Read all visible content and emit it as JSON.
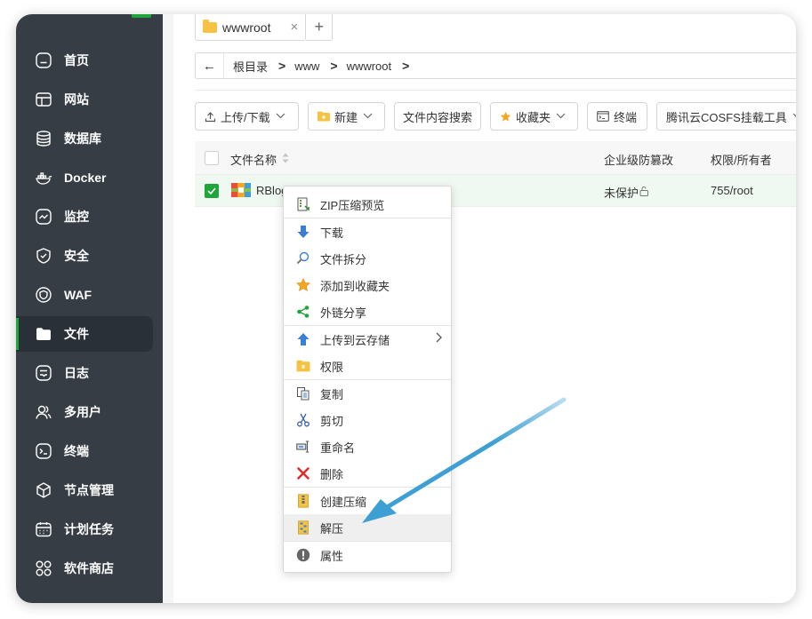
{
  "sidebar": {
    "items": [
      {
        "label": "首页",
        "icon": "home-icon"
      },
      {
        "label": "网站",
        "icon": "website-icon"
      },
      {
        "label": "数据库",
        "icon": "database-icon"
      },
      {
        "label": "Docker",
        "icon": "docker-icon"
      },
      {
        "label": "监控",
        "icon": "monitor-icon"
      },
      {
        "label": "安全",
        "icon": "shield-icon"
      },
      {
        "label": "WAF",
        "icon": "waf-icon"
      },
      {
        "label": "文件",
        "icon": "folder-icon"
      },
      {
        "label": "日志",
        "icon": "log-icon"
      },
      {
        "label": "多用户",
        "icon": "users-icon"
      },
      {
        "label": "终端",
        "icon": "terminal-icon"
      },
      {
        "label": "节点管理",
        "icon": "node-icon"
      },
      {
        "label": "计划任务",
        "icon": "calendar-icon"
      },
      {
        "label": "软件商店",
        "icon": "store-icon"
      }
    ],
    "active_index": 7
  },
  "tabs": [
    {
      "label": "wwwroot",
      "close": "×"
    }
  ],
  "tab_add": "+",
  "breadcrumb": {
    "back": "←",
    "items": [
      "根目录",
      "www",
      "wwwroot"
    ],
    "separator": ">"
  },
  "toolbar": {
    "upload_download": "上传/下载",
    "new": "新建",
    "content_search": "文件内容搜索",
    "favorites": "收藏夹",
    "terminal": "终端",
    "cosfs": "腾讯云COSFS挂载工具"
  },
  "table": {
    "columns": {
      "name": "文件名称",
      "protection": "企业级防篡改",
      "permission": "权限/所有者"
    },
    "rows": [
      {
        "name": "RBlog",
        "protection": "未保护",
        "permission": "755/root",
        "selected": true
      }
    ]
  },
  "context_menu": {
    "groups": [
      [
        {
          "label": "ZIP压缩预览",
          "icon": "zip-preview-icon"
        }
      ],
      [
        {
          "label": "下载",
          "icon": "download-icon"
        },
        {
          "label": "文件拆分",
          "icon": "split-icon"
        },
        {
          "label": "添加到收藏夹",
          "icon": "star-icon"
        },
        {
          "label": "外链分享",
          "icon": "share-icon"
        }
      ],
      [
        {
          "label": "上传到云存储",
          "icon": "upload-cloud-icon",
          "submenu": true
        },
        {
          "label": "权限",
          "icon": "permission-icon"
        }
      ],
      [
        {
          "label": "复制",
          "icon": "copy-icon"
        },
        {
          "label": "剪切",
          "icon": "cut-icon"
        },
        {
          "label": "重命名",
          "icon": "rename-icon"
        },
        {
          "label": "删除",
          "icon": "delete-icon"
        }
      ],
      [
        {
          "label": "创建压缩",
          "icon": "compress-icon"
        },
        {
          "label": "解压",
          "icon": "extract-icon",
          "highlighted": true
        }
      ],
      [
        {
          "label": "属性",
          "icon": "properties-icon"
        }
      ]
    ]
  },
  "colors": {
    "sidebar_bg": "#363d45",
    "accent_green": "#20a53a",
    "annotation_arrow": "#3d9fd3",
    "selected_row_bg": "#f0f8f2"
  }
}
